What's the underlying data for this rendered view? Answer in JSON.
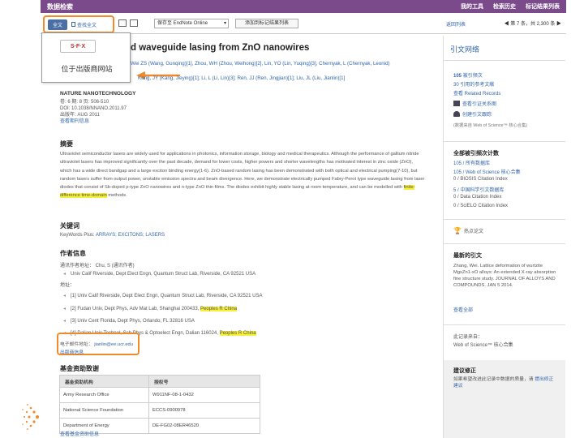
{
  "topbar": {
    "title": "数据检索",
    "links": [
      "我的工具",
      "检索历史",
      "标记结果列表"
    ]
  },
  "toolbar": {
    "fulltext_label": "全文",
    "search_all_label": "查找全文",
    "save_select_value": "保存至 EndNote Online",
    "add_marked_label": "添加到标记结果列表",
    "return_label": "返回列表",
    "record_position": "◀ 第 7 条，共 2,300 条 ▶"
  },
  "popup": {
    "sfx_label": "S·F·X",
    "locate_label": "位于出版商网站"
  },
  "article": {
    "title": "d waveguide lasing from ZnO nanowires",
    "authors_line1": "Wei ZS (Wang, Gunqing)[1], Zhou, WH (Zhou, Weihong)[2], Lin, YO (Lin, Yuqing)[3], Chernyak, L (Chernyak, Leonid)",
    "authors_line2": "Kang, JY (Kang, Jieying)[1]; Li, L (Li, Lin)[3]; Ren, JJ (Ren, Jingjian)[1]; Liu, JL (Liu, Jianlin)[1]",
    "journal": "NATURE NANOTECHNOLOGY",
    "volume_pages": "卷: 6  期: 8  页: 506-510",
    "doi": "DOI: 10.1038/NNANO.2011.97",
    "published": "出版年: AUG 2011",
    "journal_info_link": "查看期刊信息"
  },
  "abstract": {
    "heading": "摘要",
    "text_before": "Ultraviolet semiconductor lasers are widely used for applications in photonics, information storage, biology and medical therapeutics. Although the performance of gallium nitride ultraviolet lasers has improved significantly over the past decade, demand for lower costs, higher powers and shorter wavelengths has motivated interest in zinc oxide (ZnO), which has a wide direct bandgap and a large exciton binding energy(1-6). ZnO-based random lasing has been demonstrated with both optical and electrical pumping(7-10), but random lasers suffer from output power, unstable emission spectra and beam divergence. Here, we demonstrate electrically pumped Fabry-Perot type waveguide lasing from laser diodes that consist of Sb-doped p-type ZnO nanowires and n-type ZnO thin films. The diodes exhibit highly stable lasing at room temperature, and can be modelled with ",
    "text_highlight": "finite-difference time-domain",
    "text_after": " methods."
  },
  "keywords": {
    "heading": "关键词",
    "label": "KeyWords Plus:",
    "value": "ARRAYS; EXCITONS; LASERS"
  },
  "author_info": {
    "heading": "作者信息",
    "contact": "通讯作者地址：  Chu, S (通讯作者)",
    "contact_addr": "Univ Calif Riverside, Dept Elect Engn, Quantum Struct Lab, Riverside, CA 92521 USA",
    "address_label": "地址：",
    "addresses": [
      {
        "idx": "[1]",
        "text": "Univ Calif Riverside, Dept Elect Engn, Quantum Struct Lab, Riverside, CA 92521 USA",
        "hl": ""
      },
      {
        "idx": "[2]",
        "text": "Fudan Univ, Dept Phys, Adv Mat Lab, Shanghai 200433, ",
        "hl": "Peoples R China"
      },
      {
        "idx": "[3]",
        "text": "Univ Cent Florida, Dept Phys, Orlando, FL 32816 USA",
        "hl": ""
      },
      {
        "idx": "[4]",
        "text": "Dalian Univ Technol, Sch Phys & Optoelect Engn, Dalian 116024, ",
        "hl": "Peoples R China"
      }
    ],
    "email_label": "电子邮件地址：",
    "email_value": "jianlin@ee.ucr.edu",
    "email_sub": "出版商信息"
  },
  "funding": {
    "heading": "基金资助致谢",
    "col_agency": "基金资助机构",
    "col_number": "授权号",
    "rows": [
      {
        "agency": "Army Research Office",
        "number": "W911NF-08-1-0432"
      },
      {
        "agency": "National Science Foundation",
        "number": "ECCS-0900978"
      },
      {
        "agency": "Department of Energy",
        "number": "DE-FG02-08ER46520"
      }
    ],
    "more_link": "查看基金资助信息"
  },
  "sidebar": {
    "title": "引文网络",
    "times_cited_num": "105",
    "times_cited_label": "被引频次",
    "references_num": "30",
    "references_label": "引用的参考文献",
    "related_label": "查看 Related Records",
    "citation_map": "查看引证关系图",
    "citation_alert": "创建引文跟踪",
    "source_note": "(数据来自 Web of Science™ 核心合集)",
    "usage_heading": "全部被引频次计数",
    "usage_lines": [
      "105 / 所有数据库",
      "105 / Web of Science 核心合集",
      "0 / BIOSIS Citation Index",
      "5 / 中国科学引文数据库",
      "0 / Data Citation Index",
      "0 / SciELO Citation Index"
    ],
    "hot_paper": "热点论文",
    "recent_heading": "最新的引文",
    "recent_text": "Zhang, Wei. Lattice deformation of wurtzite MgxZn1-xO alloys: An extended X-ray absorption fine structure study. JOURNAL OF ALLOYS AND COMPOUNDS. JAN 5 2014.",
    "recent_link": "查看全部",
    "from_heading": "此记录来自：",
    "from_value": "Web of Science™ 核心合集",
    "suggest_heading": "建议修正",
    "suggest_text": "如果希望改进此记录中数据的质量，请",
    "suggest_link": "提出修正建议"
  },
  "colors": {
    "topbar": "#7a4a8a",
    "link": "#3366aa",
    "annotation": "#f08a2a",
    "highlight": "#f5f03a"
  }
}
